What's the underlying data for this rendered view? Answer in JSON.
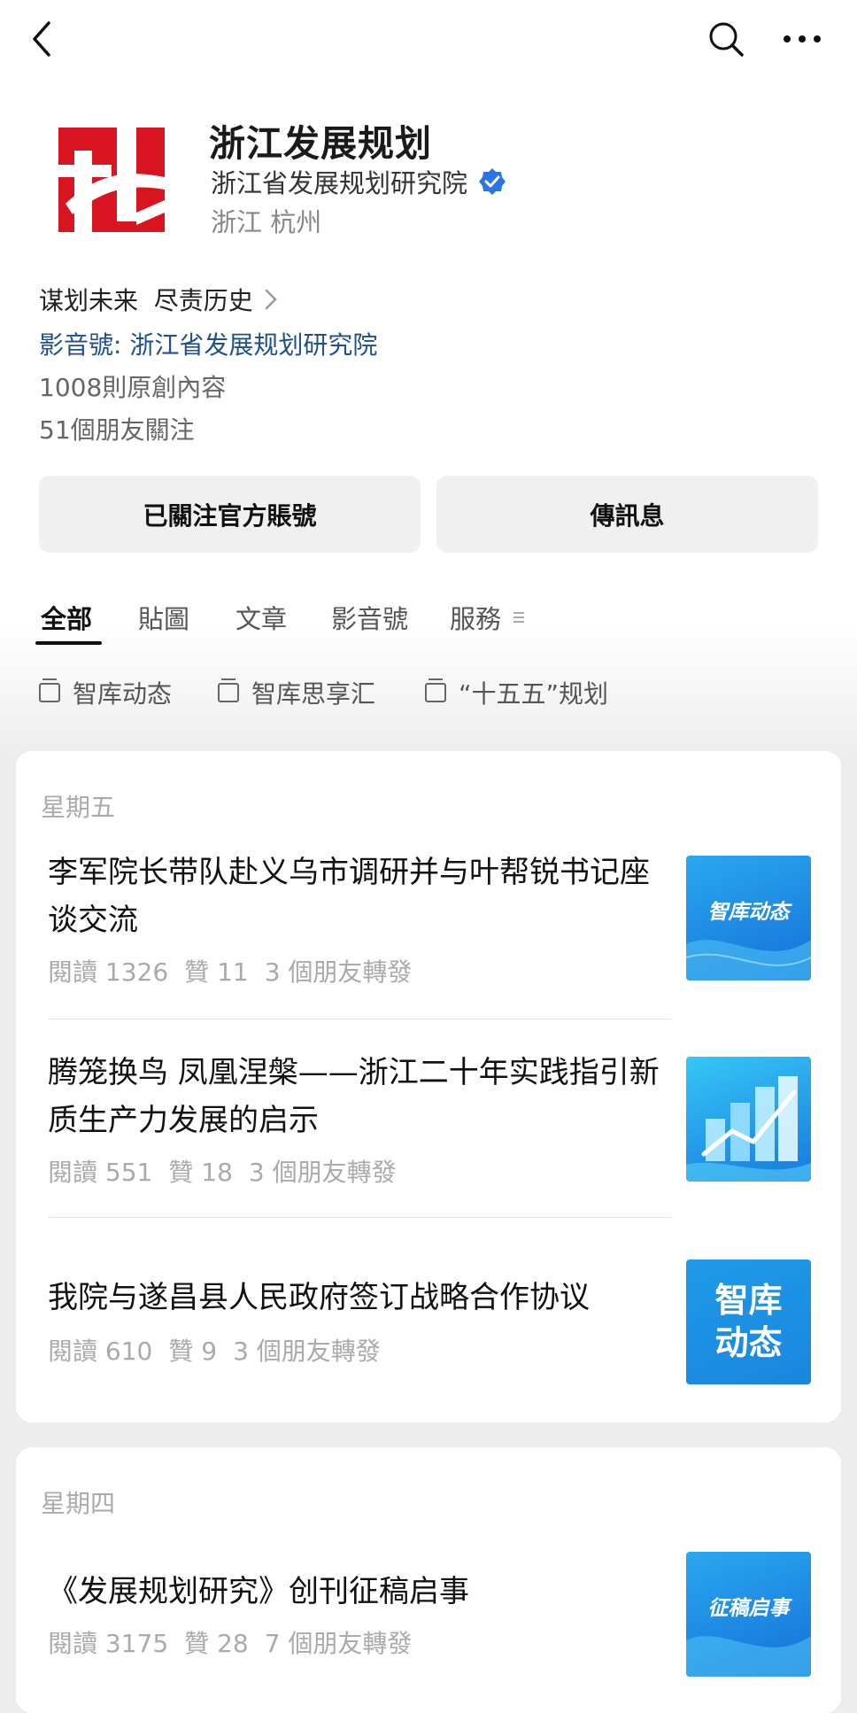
{
  "header": {
    "back_icon": "chevron-left-icon",
    "search_icon": "search-icon",
    "more_icon": "more-icon"
  },
  "profile": {
    "name": "浙江发展规划",
    "org": "浙江省发展规划研究院",
    "verified_icon": "verified-badge-icon",
    "location": "浙江 杭州",
    "slogan": "谋划未来  尽责历史",
    "channels": "影音號: 浙江省发展规划研究院",
    "original_count": "1008則原創內容",
    "friends_follow": "51個朋友關注"
  },
  "actions": {
    "follow_label": "已關注官方賬號",
    "message_label": "傳訊息"
  },
  "tabs": [
    {
      "label": "全部"
    },
    {
      "label": "貼圖"
    },
    {
      "label": "文章"
    },
    {
      "label": "影音號"
    },
    {
      "label": "服務"
    }
  ],
  "collections": [
    {
      "label": "智库动态"
    },
    {
      "label": "智库思享汇"
    },
    {
      "label": "“十五五”规划"
    }
  ],
  "groups": [
    {
      "day": "星期五",
      "articles": [
        {
          "title": "李军院长带队赴义乌市调研并与叶帮锐书记座谈交流",
          "reads": "閱讀 1326",
          "likes": "贊 11",
          "shares": "3 個朋友轉發",
          "thumb_text": "智库动态"
        },
        {
          "title": "腾笼换鸟 凤凰涅槃——浙江二十年实践指引新质生产力发展的启示",
          "reads": "閱讀 551",
          "likes": "贊 18",
          "shares": "3 個朋友轉發"
        },
        {
          "title": "我院与遂昌县人民政府签订战略合作协议",
          "reads": "閱讀 610",
          "likes": "贊 9",
          "shares": "3 個朋友轉發",
          "thumb_line1": "智库",
          "thumb_line2": "动态"
        }
      ]
    },
    {
      "day": "星期四",
      "articles": [
        {
          "title": "《发展规划研究》创刊征稿启事",
          "reads": "閱讀 3175",
          "likes": "贊 28",
          "shares": "7 個朋友轉發",
          "thumb_text": "征稿启事"
        }
      ]
    }
  ],
  "colors": {
    "brand_red": "#d7141f",
    "link_blue": "#1f4f8f",
    "verified_blue": "#2a74e5",
    "thumb_blue": "#1d8fe0"
  }
}
